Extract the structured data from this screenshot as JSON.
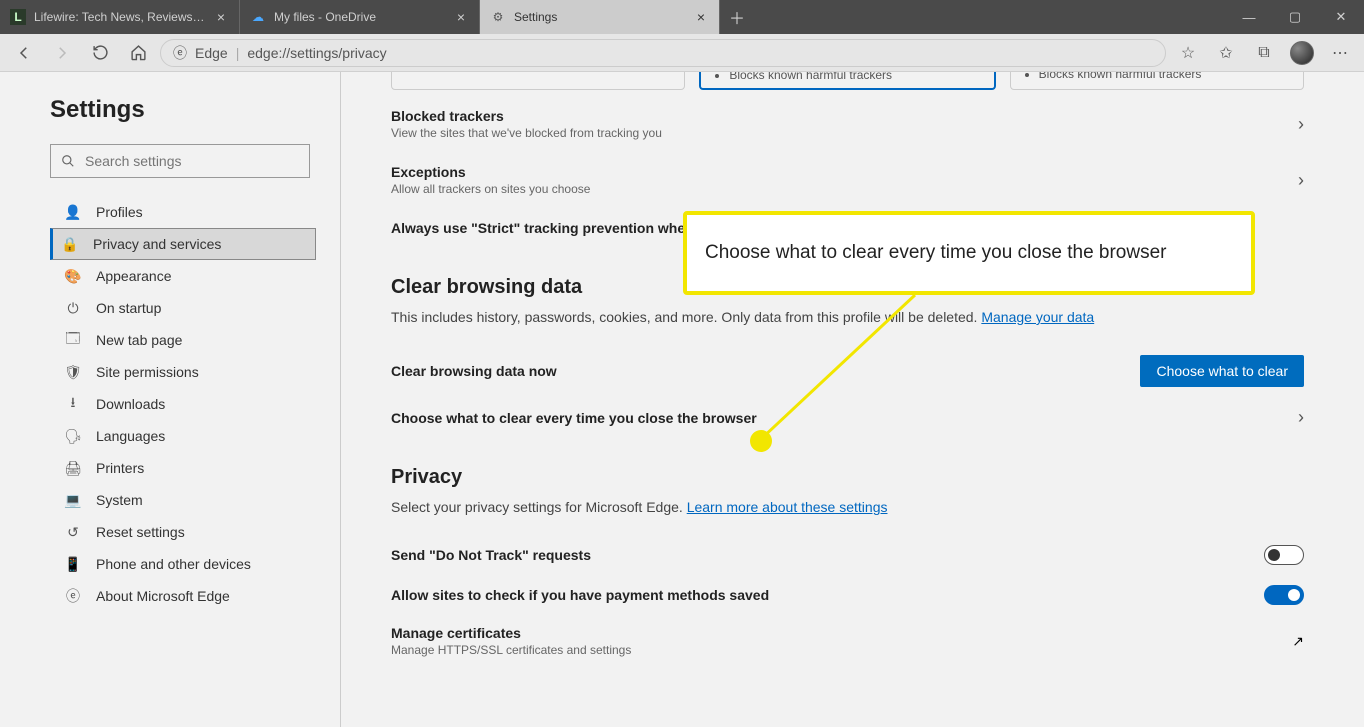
{
  "tabs": [
    {
      "label": "Lifewire: Tech News, Reviews, He",
      "favicon": "L"
    },
    {
      "label": "My files - OneDrive",
      "favicon": "☁"
    },
    {
      "label": "Settings",
      "favicon": "⚙"
    }
  ],
  "toolbar": {
    "addr_prefix": "Edge",
    "addr_url": "edge://settings/privacy"
  },
  "sidebar": {
    "title": "Settings",
    "search_placeholder": "Search settings",
    "items": [
      {
        "icon": "👤",
        "label": "Profiles"
      },
      {
        "icon": "🔒",
        "label": "Privacy and services"
      },
      {
        "icon": "🎨",
        "label": "Appearance"
      },
      {
        "icon": "⏻",
        "label": "On startup"
      },
      {
        "icon": "🗔",
        "label": "New tab page"
      },
      {
        "icon": "🛡",
        "label": "Site permissions"
      },
      {
        "icon": "⭳",
        "label": "Downloads"
      },
      {
        "icon": "🗣",
        "label": "Languages"
      },
      {
        "icon": "🖨",
        "label": "Printers"
      },
      {
        "icon": "💻",
        "label": "System"
      },
      {
        "icon": "↺",
        "label": "Reset settings"
      },
      {
        "icon": "📱",
        "label": "Phone and other devices"
      },
      {
        "icon": "ⓔ",
        "label": "About Microsoft Edge"
      }
    ]
  },
  "tracking": {
    "bullet_balanced": "Blocks known harmful trackers",
    "bullet_strict": "Blocks known harmful trackers",
    "blocked_title": "Blocked trackers",
    "blocked_sub": "View the sites that we've blocked from tracking you",
    "exceptions_title": "Exceptions",
    "exceptions_sub": "Allow all trackers on sites you choose",
    "strict_label": "Always use \"Strict\" tracking prevention whe"
  },
  "clear": {
    "title": "Clear browsing data",
    "sub_pre": "This includes history, passwords, cookies, and more. Only data from this profile will be deleted. ",
    "sub_link": "Manage your data",
    "now_label": "Clear browsing data now",
    "button": "Choose what to clear",
    "every_time": "Choose what to clear every time you close the browser"
  },
  "privacy": {
    "title": "Privacy",
    "sub_pre": "Select your privacy settings for Microsoft Edge. ",
    "sub_link": "Learn more about these settings",
    "dnt": "Send \"Do Not Track\" requests",
    "payment": "Allow sites to check if you have payment methods saved",
    "certs_title": "Manage certificates",
    "certs_sub": "Manage HTTPS/SSL certificates and settings"
  },
  "callout": {
    "text": "Choose what to clear every time you close the browser"
  }
}
